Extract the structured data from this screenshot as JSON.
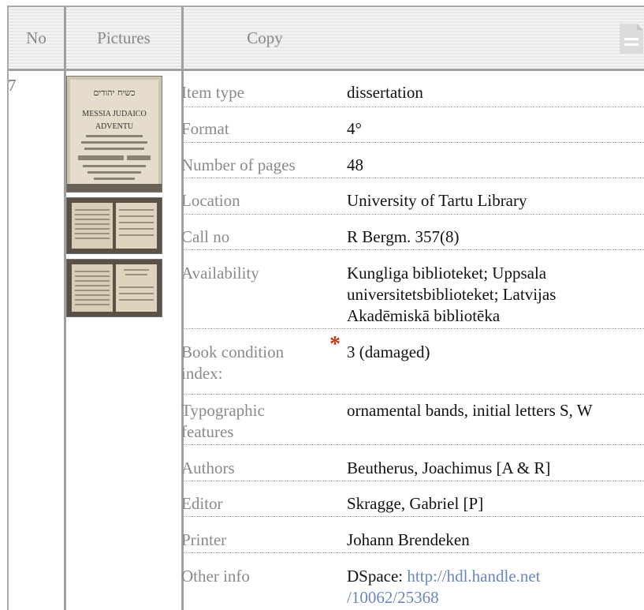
{
  "header": {
    "col_no": "No",
    "col_pictures": "Pictures",
    "col_copy": "Copy"
  },
  "row": {
    "no": "7",
    "thumbnails": [
      {
        "name": "title-page-thumbnail",
        "text_lines": [
          "כשיח יהודים",
          "MESSIA JUDAICO",
          "ADVENTU"
        ]
      },
      {
        "name": "open-book-thumbnail-1"
      },
      {
        "name": "open-book-thumbnail-2"
      }
    ],
    "fields": [
      {
        "label": "Item type",
        "value": "dissertation"
      },
      {
        "label": "Format",
        "value": "4°"
      },
      {
        "label": "Number of pages",
        "value": "48"
      },
      {
        "label": "Location",
        "value": "University of Tartu Library"
      },
      {
        "label": "Call no",
        "value": "R Bergm. 357(8)"
      },
      {
        "label": "Availability",
        "value": "Kungliga biblioteket; Uppsala universitetsbiblioteket; Latvijas Akadēmiskā bibliotēka"
      },
      {
        "label": "Book condition index:",
        "value": "3 (damaged)",
        "marker": "*"
      },
      {
        "label": "Typographic features",
        "value": "ornamental bands, initial letters S, W"
      },
      {
        "label": "Authors",
        "value": "Beutherus, Joachimus [A & R]"
      },
      {
        "label": "Editor",
        "value": "Skragge, Gabriel [P]"
      },
      {
        "label": "Printer",
        "value": "Johann Brendeken"
      },
      {
        "label": "Other info",
        "value_prefix": "DSpace: ",
        "link": "http://hdl.handle.net/10062/25368",
        "link_line1": "http://hdl.handle.net",
        "link_line2": "/10062/25368"
      }
    ]
  },
  "colors": {
    "link": "#6a86c0",
    "marker": "#c0391b"
  }
}
